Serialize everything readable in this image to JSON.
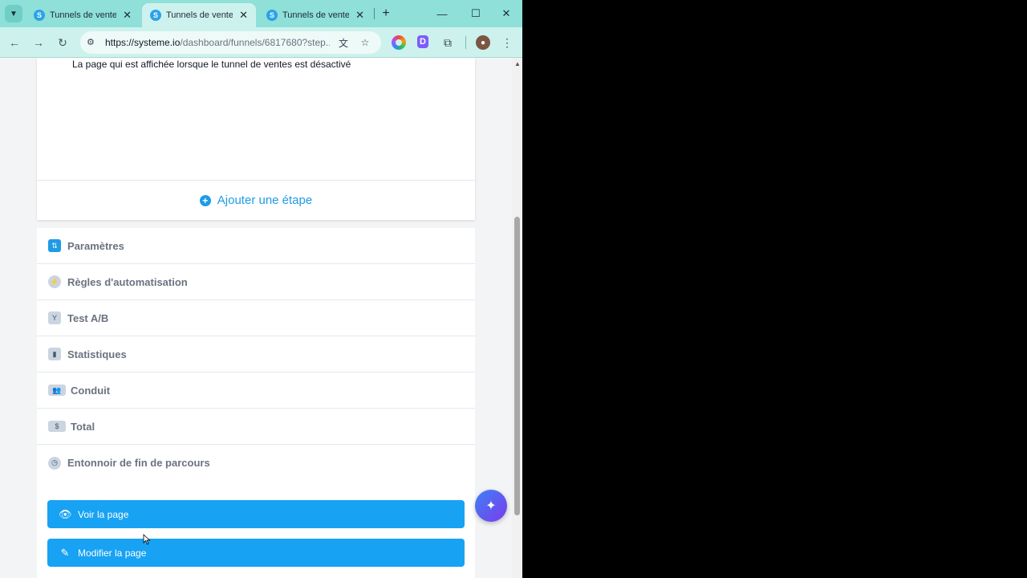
{
  "browser": {
    "tabs": [
      {
        "title": "Tunnels de vente",
        "active": false
      },
      {
        "title": "Tunnels de vente",
        "active": true
      },
      {
        "title": "Tunnels de vente",
        "active": false
      }
    ],
    "favicon_letter": "S",
    "url_host": "https://systeme.io",
    "url_path": "/dashboard/funnels/6817680?step...",
    "icons": {
      "tab_menu": "chevron-down-icon",
      "close_tab": "close-icon",
      "new_tab": "plus-icon",
      "minimize": "minimize-icon",
      "maximize": "maximize-icon",
      "close_window": "close-icon",
      "back": "back-arrow-icon",
      "forward": "forward-arrow-icon",
      "reload": "reload-icon",
      "site_info": "site-settings-icon",
      "translate": "translate-icon",
      "bookmark": "star-icon",
      "extensions": "puzzle-icon",
      "menu": "kebab-menu-icon"
    }
  },
  "page": {
    "step_description": "La page qui est affichée lorsque le tunnel de ventes est désactivé",
    "add_step_label": "Ajouter une étape",
    "settings_items": [
      {
        "label": "Paramètres",
        "icon": "sliders-icon"
      },
      {
        "label": "Règles d'automatisation",
        "icon": "lightning-icon"
      },
      {
        "label": "Test A/B",
        "icon": "split-icon"
      },
      {
        "label": "Statistiques",
        "icon": "bar-chart-icon"
      },
      {
        "label": "Conduit",
        "icon": "users-icon"
      },
      {
        "label": "Total",
        "icon": "dollar-icon"
      },
      {
        "label": "Entonnoir de fin de parcours",
        "icon": "clock-icon"
      }
    ],
    "view_page_label": "Voir la page",
    "edit_page_label": "Modifier la page"
  },
  "colors": {
    "primary": "#17a2f3",
    "tab_strip": "#8ee0d8",
    "toolbar": "#cdf2ee"
  }
}
